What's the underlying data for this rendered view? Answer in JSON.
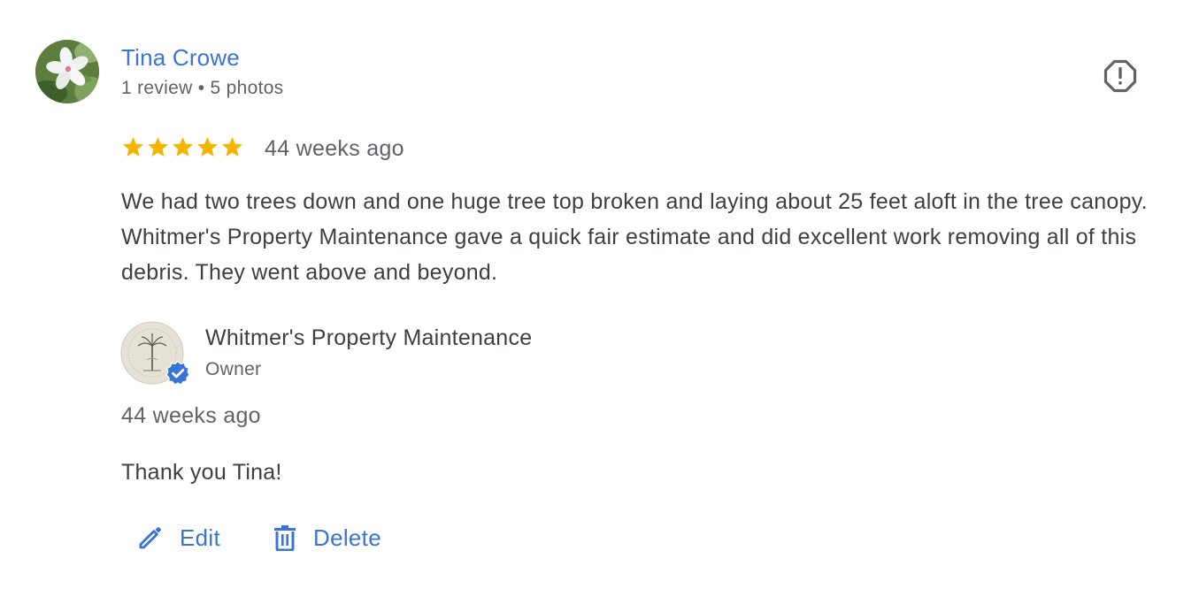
{
  "reviewer": {
    "name": "Tina Crowe",
    "meta": "1 review • 5 photos"
  },
  "review": {
    "rating": 5,
    "max_rating": 5,
    "time": "44 weeks ago",
    "text": "We had two trees down and one huge tree top broken and laying about 25 feet aloft in the tree canopy. Whitmer's Property Maintenance gave a quick fair estimate and did excellent work removing all of this debris. They went above and beyond."
  },
  "owner_reply": {
    "name": "Whitmer's Property Maintenance",
    "role": "Owner",
    "time": "44 weeks ago",
    "text": "Thank you Tina!"
  },
  "actions": {
    "edit_label": "Edit",
    "delete_label": "Delete"
  },
  "icons": {
    "flag": "flag-report-icon",
    "edit": "pencil-icon",
    "delete": "trash-icon",
    "verified": "verified-badge-icon",
    "star": "star-icon"
  },
  "colors": {
    "link": "#3a74d6",
    "star": "#f4b400",
    "text": "#3c4043",
    "secondary": "#5f6368",
    "verified": "#3a74d6"
  }
}
